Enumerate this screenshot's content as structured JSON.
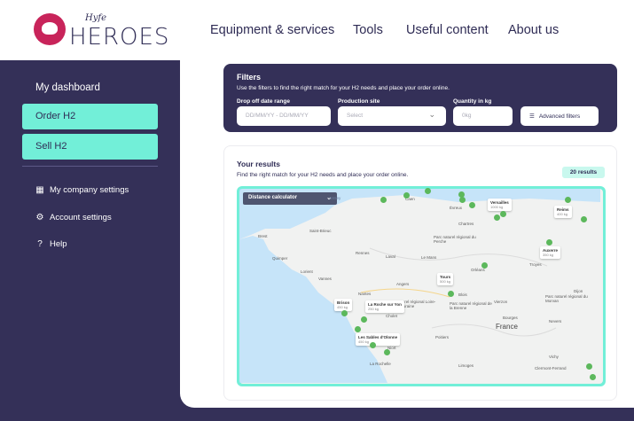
{
  "brand": {
    "script": "Hyfe",
    "name": "HEROES"
  },
  "nav": [
    "Equipment & services",
    "Tools",
    "Useful content",
    "About us"
  ],
  "sidebar": {
    "title": "My dashboard",
    "buttons": [
      "Order H2",
      "Sell H2"
    ],
    "items": [
      {
        "label": "My company settings",
        "icon": "building-icon"
      },
      {
        "label": "Account settings",
        "icon": "gear-icon"
      },
      {
        "label": "Help",
        "icon": "help-icon"
      }
    ]
  },
  "filters": {
    "title": "Filters",
    "description": "Use the filters to find the right match for your H2 needs and place your order online.",
    "date_label": "Drop off date range",
    "date_placeholder": "DD/MM/YY - DD/MM/YY",
    "site_label": "Production site",
    "site_placeholder": "Select",
    "qty_label": "Quantity in kg",
    "qty_placeholder": "0kg",
    "advanced_label": "Advanced filters"
  },
  "results": {
    "title": "Your results",
    "description": "Find the right match for your H2 needs and place your order online.",
    "count_label": "20 results",
    "distance_label": "Distance calculator",
    "country_label": "France",
    "popups": [
      {
        "name": "Versailles",
        "qty": "1000 kg"
      },
      {
        "name": "Reims",
        "qty": "400 kg"
      },
      {
        "name": "Auxerre",
        "qty": "350 kg"
      },
      {
        "name": "Tours",
        "qty": "500 kg"
      },
      {
        "name": "Brison",
        "qty": "450 kg"
      },
      {
        "name": "La Roche sur Yon",
        "qty": "250 kg"
      },
      {
        "name": "Les Sables d'Olonne",
        "qty": "450 kg"
      }
    ],
    "places": [
      "Jersey",
      "Brest",
      "Saint-Brieuc",
      "Quimper",
      "Lorient",
      "Vannes",
      "Rennes",
      "Le Mans",
      "Laval",
      "Angers",
      "Nantes",
      "Cholet",
      "Poitiers",
      "Niort",
      "La Rochelle",
      "Caen",
      "Orléans",
      "Blois",
      "Bourges",
      "Vierzon",
      "Nevers",
      "Vichy",
      "Limoges",
      "Clermont-Ferrand",
      "Troyes",
      "Dijon",
      "Chartres",
      "Évreux",
      "Parc naturel régional du Perche",
      "Parc naturel régional de la Brenne",
      "Parc naturel régional du Morvan",
      "Parc naturel régional Loire-Anjou-Touraine"
    ]
  },
  "colors": {
    "navy": "#343058",
    "mint": "#72efd8",
    "magenta": "#c8245a",
    "pin": "#5cb85c"
  }
}
